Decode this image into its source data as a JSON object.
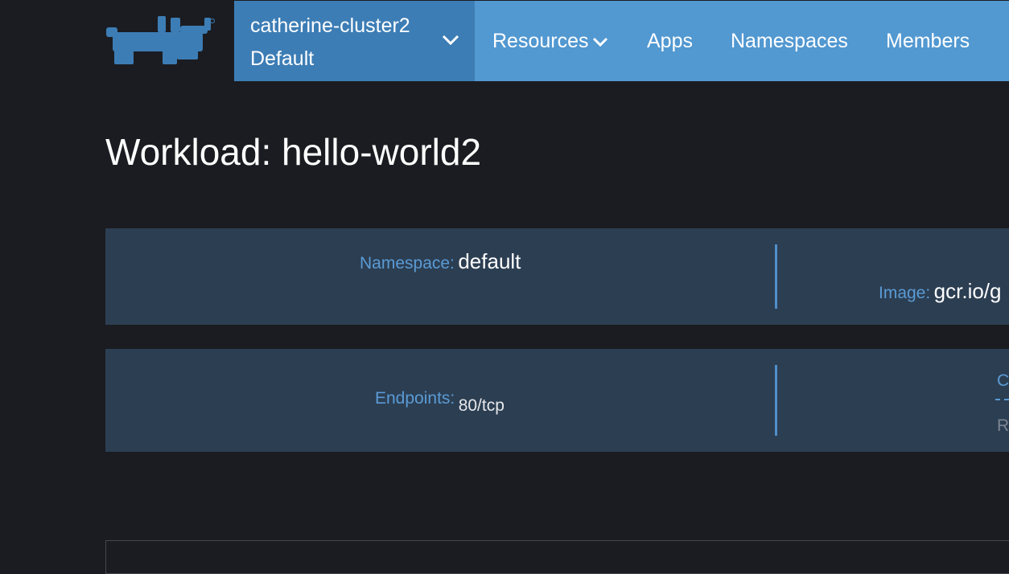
{
  "header": {
    "logo_icon": "rancher-cow-logo-icon",
    "cluster": "catherine-cluster2",
    "project": "Default",
    "cluster_menu_icon": "chevron-down-icon",
    "nav": [
      {
        "label": "Resources",
        "has_dropdown": true
      },
      {
        "label": "Apps",
        "has_dropdown": false
      },
      {
        "label": "Namespaces",
        "has_dropdown": false
      },
      {
        "label": "Members",
        "has_dropdown": false
      }
    ]
  },
  "page": {
    "title": "Workload: hello-world2"
  },
  "details": {
    "namespace": {
      "label": "Namespace:",
      "value": "default"
    },
    "image": {
      "label": "Image:",
      "value": "gcr.io/g"
    },
    "endpoints": {
      "label": "Endpoints:",
      "value": "80/tcp"
    },
    "cutoff_link": "C",
    "cutoff_text": "R"
  },
  "colors": {
    "background": "#1b1c21",
    "cluster_switch": "#3d7db5",
    "nav_bar": "#5298d1",
    "panel": "#2c3e52",
    "label": "#5a9bd5",
    "divider": "#4f8fca"
  }
}
